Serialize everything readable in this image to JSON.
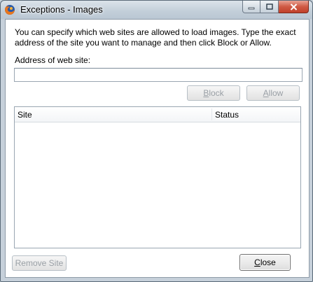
{
  "window": {
    "title": "Exceptions - Images",
    "icon": "firefox-icon",
    "caption_icons": [
      "minimize-icon",
      "maximize-icon",
      "close-icon"
    ]
  },
  "content": {
    "description": "You can specify which web sites are allowed to load images. Type the exact address of the site you want to manage and then click Block or Allow.",
    "address_label": "Address of web site:",
    "address_value": "",
    "address_placeholder": ""
  },
  "buttons": {
    "block": {
      "accel": "B",
      "rest": "lock",
      "enabled": false
    },
    "allow": {
      "accel": "A",
      "rest": "llow",
      "enabled": false
    },
    "remove_site": {
      "label": "Remove Site",
      "enabled": false
    },
    "close": {
      "accel": "C",
      "rest": "lose",
      "enabled": true
    }
  },
  "table": {
    "columns": [
      "Site",
      "Status"
    ],
    "rows": []
  }
}
